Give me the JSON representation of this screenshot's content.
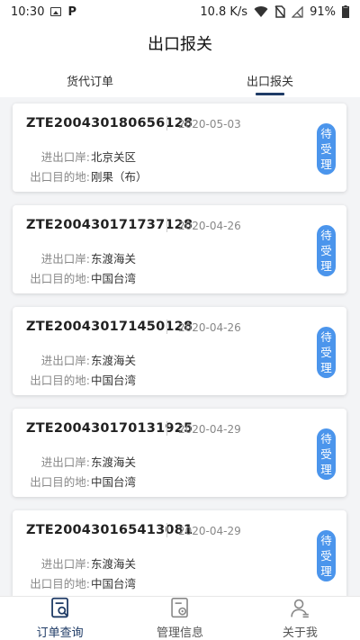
{
  "status_bar": {
    "time": "10:30",
    "network": "10.8 K/s",
    "battery": "91%",
    "icons": [
      "image-icon",
      "p-icon",
      "wifi-icon",
      "sim-off-icon",
      "signal-off-icon",
      "battery-icon"
    ]
  },
  "header": {
    "title": "出口报关"
  },
  "tabs": [
    {
      "label": "货代订单",
      "active": false
    },
    {
      "label": "出口报关",
      "active": true
    }
  ],
  "labels": {
    "port": "进出口岸:",
    "destination": "出口目的地:"
  },
  "orders": [
    {
      "order_no": "ZTE200430180656128",
      "date": "2020-05-03",
      "port": "北京关区",
      "destination": "刚果（布）",
      "status": [
        "待",
        "受",
        "理"
      ]
    },
    {
      "order_no": "ZTE200430171737128",
      "date": "2020-04-26",
      "port": "东渡海关",
      "destination": "中国台湾",
      "status": [
        "待",
        "受",
        "理"
      ]
    },
    {
      "order_no": "ZTE200430171450128",
      "date": "2020-04-26",
      "port": "东渡海关",
      "destination": "中国台湾",
      "status": [
        "待",
        "受",
        "理"
      ]
    },
    {
      "order_no": "ZTE200430170131925",
      "date": "2020-04-29",
      "port": "东渡海关",
      "destination": "中国台湾",
      "status": [
        "待",
        "受",
        "理"
      ]
    },
    {
      "order_no": "ZTE200430165413081",
      "date": "2020-04-29",
      "port": "东渡海关",
      "destination": "中国台湾",
      "status": [
        "待",
        "受",
        "理"
      ]
    }
  ],
  "bottom_nav": [
    {
      "label": "订单查询",
      "icon": "order-search-icon",
      "active": true
    },
    {
      "label": "管理信息",
      "icon": "settings-doc-icon",
      "active": false
    },
    {
      "label": "关于我",
      "icon": "user-icon",
      "active": false
    }
  ],
  "colors": {
    "accent": "#1f3b66",
    "badge": "#4b95ec",
    "background": "#f3f4f6"
  }
}
